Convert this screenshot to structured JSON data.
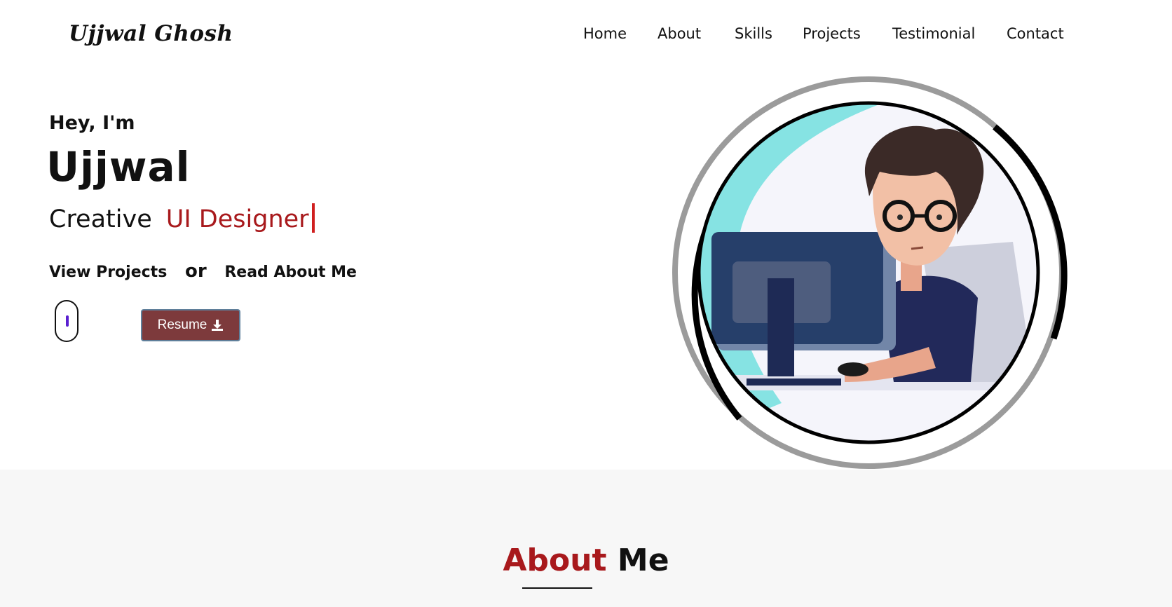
{
  "header": {
    "logo": "Ujjwal Ghosh",
    "nav": [
      "Home",
      "About",
      "Skills",
      "Projects",
      "Testimonial",
      "Contact"
    ]
  },
  "hero": {
    "greeting": "Hey, I'm",
    "name": "Ujjwal",
    "role_prefix": "Creative",
    "role_accent": "UI Designer",
    "cta_projects": "View Projects",
    "cta_or": "or",
    "cta_about": "Read About Me",
    "resume_label": "Resume",
    "resume_icon": "download-icon",
    "scroll_icon": "mouse-scroll-icon"
  },
  "about": {
    "title_accent": "About",
    "title_rest": "Me"
  },
  "colors": {
    "accent": "#a8191c",
    "resume_button": "#7d3a3c",
    "section_bg": "#f7f7f7"
  }
}
